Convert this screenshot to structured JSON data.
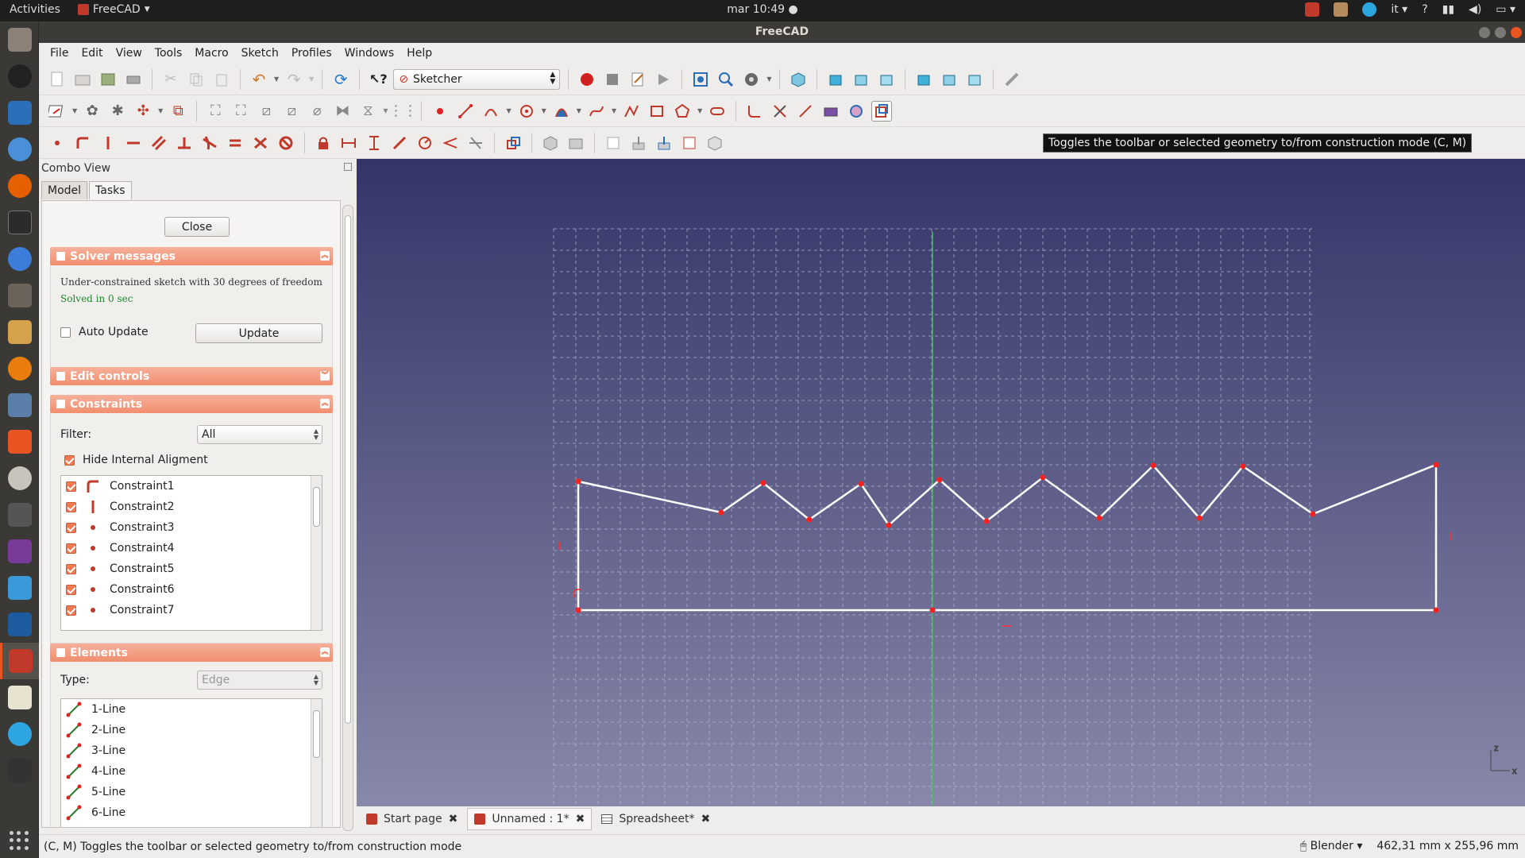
{
  "topbar": {
    "activities": "Activities",
    "app_menu": "FreeCAD",
    "clock": "mar 10:49",
    "lang": "it",
    "help": "?"
  },
  "window": {
    "title": "FreeCAD"
  },
  "menu": [
    "File",
    "Edit",
    "View",
    "Tools",
    "Macro",
    "Sketch",
    "Profiles",
    "Windows",
    "Help"
  ],
  "workbench": {
    "selected": "Sketcher"
  },
  "tooltip": "Toggles the toolbar or selected geometry to/from construction mode (C, M)",
  "combo": {
    "title": "Combo View",
    "tabs": [
      "Model",
      "Tasks"
    ],
    "close_label": "Close",
    "solver": {
      "header": "Solver messages",
      "message": "Under-constrained sketch with 30 degrees of freedom",
      "solved": "Solved in 0 sec",
      "auto_update": "Auto Update",
      "update_label": "Update"
    },
    "edit_controls": {
      "header": "Edit controls"
    },
    "constraints": {
      "header": "Constraints",
      "filter_label": "Filter:",
      "filter_value": "All",
      "hide_internal": "Hide Internal Aligment",
      "items": [
        "Constraint1",
        "Constraint2",
        "Constraint3",
        "Constraint4",
        "Constraint5",
        "Constraint6",
        "Constraint7"
      ]
    },
    "elements": {
      "header": "Elements",
      "type_label": "Type:",
      "type_value": "Edge",
      "items": [
        "1-Line",
        "2-Line",
        "3-Line",
        "4-Line",
        "5-Line",
        "6-Line"
      ]
    }
  },
  "doc_tabs": [
    {
      "label": "Start page"
    },
    {
      "label": "Unnamed : 1*"
    },
    {
      "label": "Spreadsheet*"
    }
  ],
  "status": {
    "message": "(C, M) Toggles the toolbar or selected geometry to/from construction mode",
    "nav_style": "Blender",
    "dimensions": "462,31 mm x 255,96 mm"
  },
  "axis_labels": {
    "z": "z",
    "x": "x"
  },
  "colors": {
    "accent": "#e95420",
    "section": "#f18e6e",
    "sketch_point": "#ff2020",
    "y_axis": "#33cc55",
    "geometry": "#ffffff"
  }
}
